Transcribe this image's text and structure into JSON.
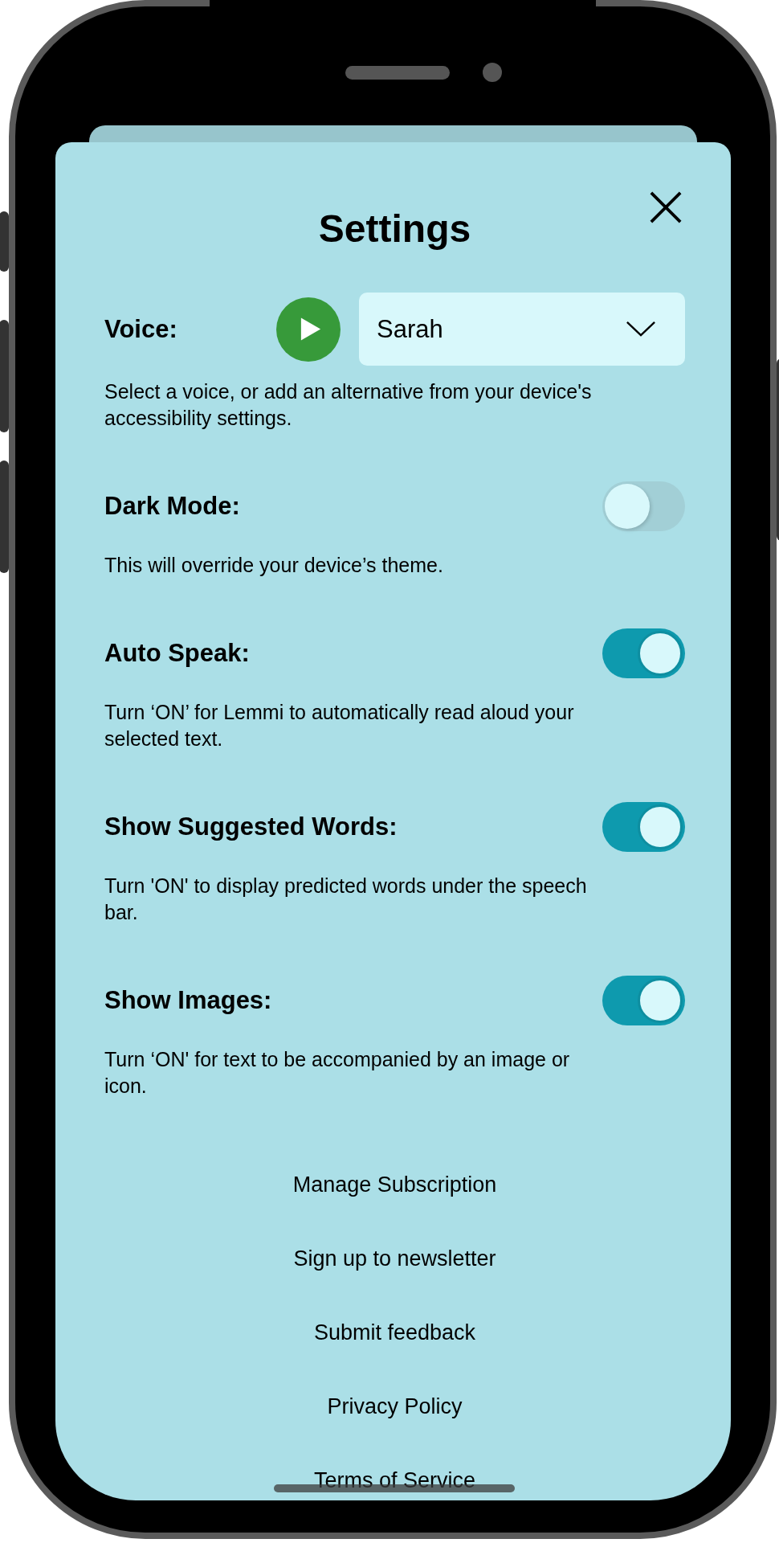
{
  "title": "Settings",
  "voice": {
    "label": "Voice:",
    "value": "Sarah",
    "description": "Select a voice, or add an alternative from your device's accessibility settings."
  },
  "settings": [
    {
      "label": "Dark Mode:",
      "description": "This will override your device’s theme.",
      "on": false
    },
    {
      "label": "Auto Speak:",
      "description": "Turn ‘ON’ for Lemmi to automatically read aloud your selected text.",
      "on": true
    },
    {
      "label": "Show Suggested Words:",
      "description": "Turn 'ON' to display predicted words under the speech bar.",
      "on": true
    },
    {
      "label": "Show Images:",
      "description": "Turn ‘ON' for text to be accompanied by an image or icon.",
      "on": true
    }
  ],
  "links": [
    "Manage Subscription",
    "Sign up to newsletter",
    "Submit feedback",
    "Privacy Policy",
    "Terms of Service"
  ]
}
